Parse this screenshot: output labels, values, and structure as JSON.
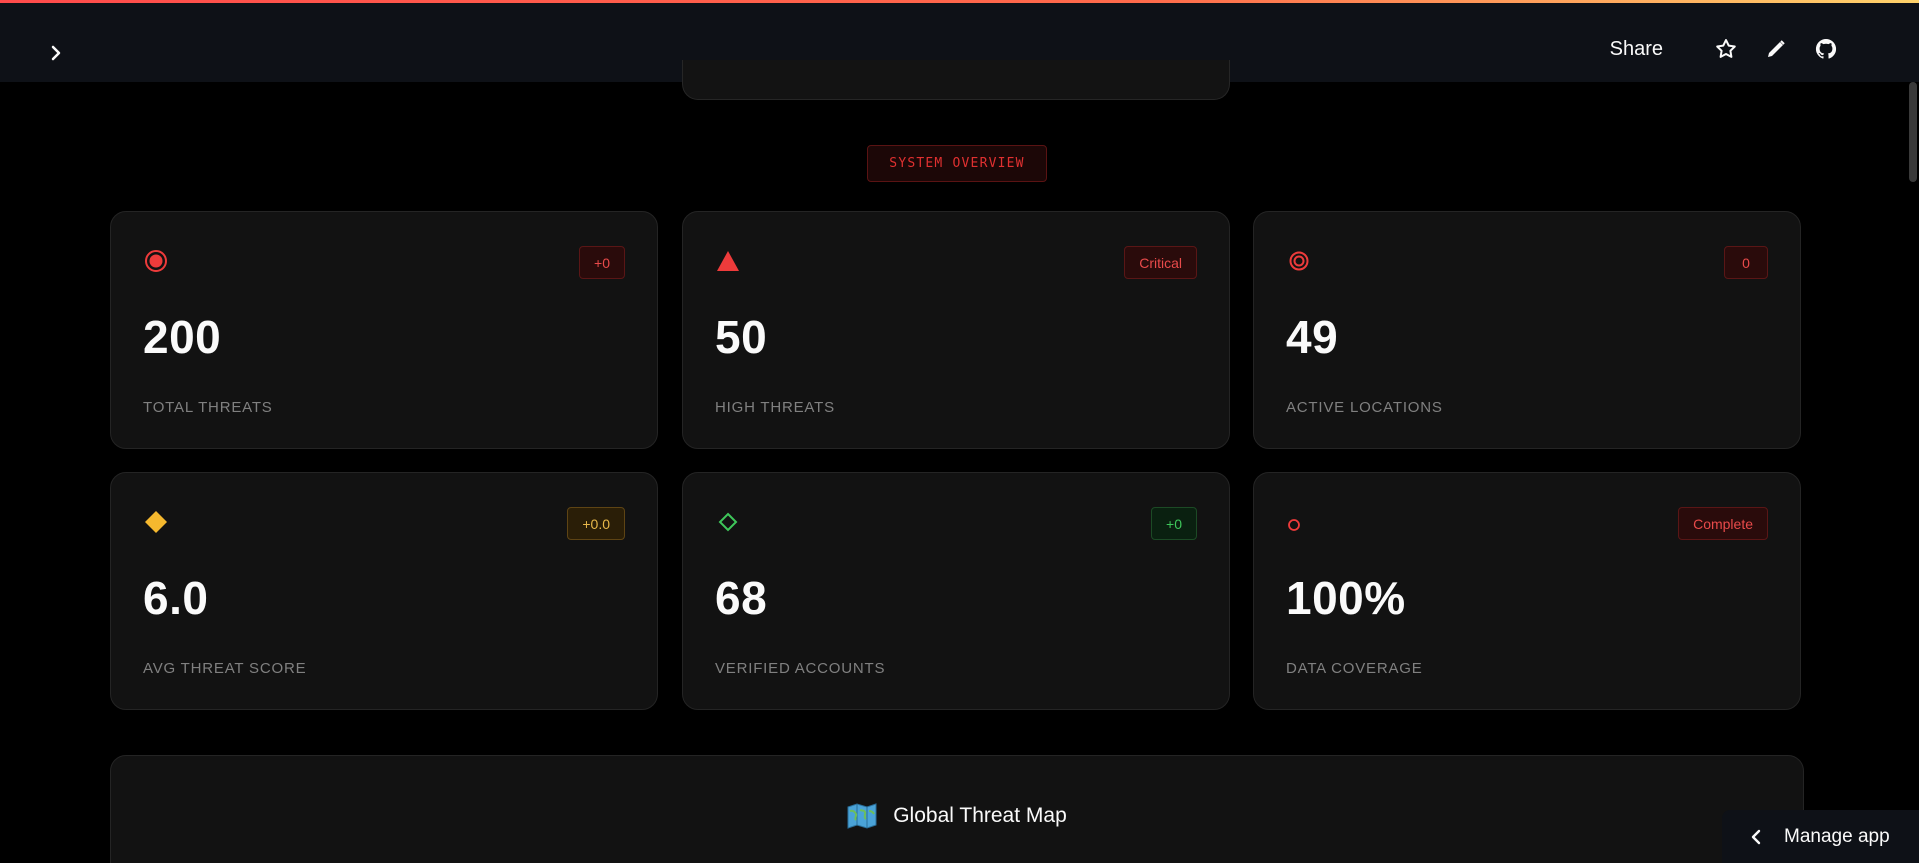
{
  "header": {
    "share_label": "Share",
    "icons": [
      "chevron-right-icon",
      "star-icon",
      "pencil-icon",
      "github-icon"
    ]
  },
  "section": {
    "title": "SYSTEM OVERVIEW"
  },
  "metrics": [
    {
      "icon": "target-icon",
      "badge": "+0",
      "badge_color": "red",
      "value": "200",
      "label": "TOTAL THREATS"
    },
    {
      "icon": "triangle-icon",
      "badge": "Critical",
      "badge_color": "red",
      "value": "50",
      "label": "HIGH THREATS"
    },
    {
      "icon": "ring-icon",
      "badge": "0",
      "badge_color": "red",
      "value": "49",
      "label": "ACTIVE LOCATIONS"
    },
    {
      "icon": "diamond-filled-icon",
      "badge": "+0.0",
      "badge_color": "amber",
      "value": "6.0",
      "label": "AVG THREAT SCORE"
    },
    {
      "icon": "diamond-outline-icon",
      "badge": "+0",
      "badge_color": "green",
      "value": "68",
      "label": "VERIFIED ACCOUNTS"
    },
    {
      "icon": "circle-outline-icon",
      "badge": "Complete",
      "badge_color": "red",
      "value": "100%",
      "label": "DATA COVERAGE"
    }
  ],
  "map": {
    "icon": "world-map-icon",
    "title": "Global Threat Map"
  },
  "manage_app": {
    "label": "Manage app"
  },
  "colors": {
    "accent_red": "#e03030",
    "amber": "#f5b82e",
    "green": "#3ec65a",
    "background": "#000000",
    "card": "#121212"
  }
}
